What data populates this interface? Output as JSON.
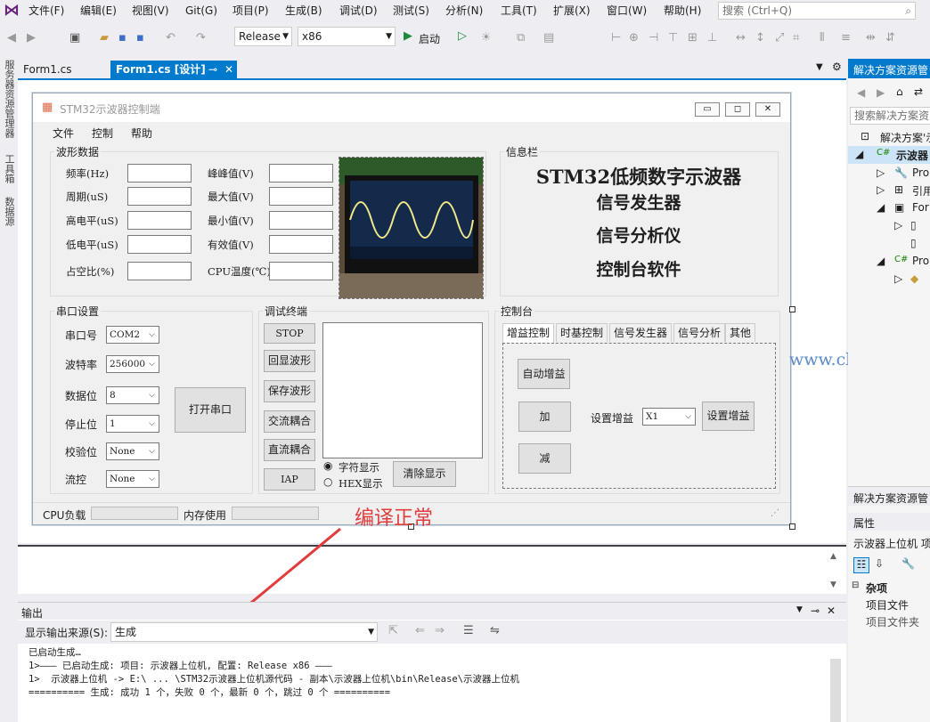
{
  "menu": {
    "items": [
      "文件(F)",
      "编辑(E)",
      "视图(V)",
      "Git(G)",
      "项目(P)",
      "生成(B)",
      "调试(D)",
      "测试(S)",
      "分析(N)",
      "工具(T)",
      "扩展(X)",
      "窗口(W)",
      "帮助(H)"
    ],
    "search_placeholder": "搜索 (Ctrl+Q)"
  },
  "toolbar": {
    "config": "Release",
    "platform": "x86",
    "start_label": "启动"
  },
  "left_strip": [
    "服务器资源管理器",
    "工具箱",
    "数据源"
  ],
  "doc_tabs": [
    {
      "label": "Form1.cs"
    },
    {
      "label": "Form1.cs [设计]"
    }
  ],
  "form": {
    "title": "STM32示波器控制端",
    "menu": [
      "文件",
      "控制",
      "帮助"
    ],
    "waveform": {
      "label": "波形数据",
      "left_fields": [
        "频率(Hz)",
        "周期(uS)",
        "高电平(uS)",
        "低电平(uS)",
        "占空比(%)"
      ],
      "right_fields": [
        "峰峰值(V)",
        "最大值(V)",
        "最小值(V)",
        "有效值(V)",
        "CPU温度(℃)"
      ]
    },
    "info": {
      "label": "信息栏",
      "lines": [
        "STM32低频数字示波器",
        "信号发生器",
        "信号分析仪",
        "控制台软件"
      ]
    },
    "serial": {
      "label": "串口设置",
      "fields": [
        {
          "label": "串口号",
          "value": "COM2"
        },
        {
          "label": "波特率",
          "value": "256000"
        },
        {
          "label": "数据位",
          "value": "8"
        },
        {
          "label": "停止位",
          "value": "1"
        },
        {
          "label": "校验位",
          "value": "None"
        },
        {
          "label": "流控",
          "value": "None"
        }
      ],
      "open_button": "打开串口"
    },
    "debug": {
      "label": "调试终端",
      "buttons": [
        "STOP",
        "回显波形",
        "保存波形",
        "交流耦合",
        "直流耦合",
        "IAP"
      ],
      "radio_char": "字符显示",
      "radio_hex": "HEX显示",
      "clear_button": "清除显示"
    },
    "console": {
      "label": "控制台",
      "tabs": [
        "增益控制",
        "时基控制",
        "信号发生器",
        "信号分析",
        "其他"
      ],
      "auto_gain": "自动增益",
      "plus": "加",
      "minus": "减",
      "gain_label": "设置增益",
      "gain_value": "X1",
      "set_gain": "设置增益"
    },
    "status": {
      "cpu": "CPU负载",
      "mem": "内存使用"
    }
  },
  "watermark": "www.cleok.com",
  "annotation": "编译正常",
  "output": {
    "title": "输出",
    "source_label": "显示输出来源(S):",
    "source_value": "生成",
    "lines": [
      "已启动生成…",
      "1>——— 已启动生成: 项目: 示波器上位机, 配置: Release x86 ———",
      "1>  示波器上位机 -> E:\\ ... \\STM32示波器上位机源代码 - 副本\\示波器上位机\\bin\\Release\\示波器上位机",
      "========== 生成: 成功 1 个，失败 0 个，最新 0 个，跳过 0 个 =========="
    ]
  },
  "solution": {
    "title": "解决方案资源管",
    "search": "搜索解决方案资",
    "items": [
      "解决方案'示",
      "示波器",
      "Pro",
      "引用",
      "For",
      "Pro"
    ]
  },
  "properties": {
    "title": "属性",
    "object": "示波器上位机 项",
    "category": "杂项",
    "rows": [
      "项目文件",
      "项目文件夹"
    ]
  },
  "solution_footer": "解决方案资源管"
}
